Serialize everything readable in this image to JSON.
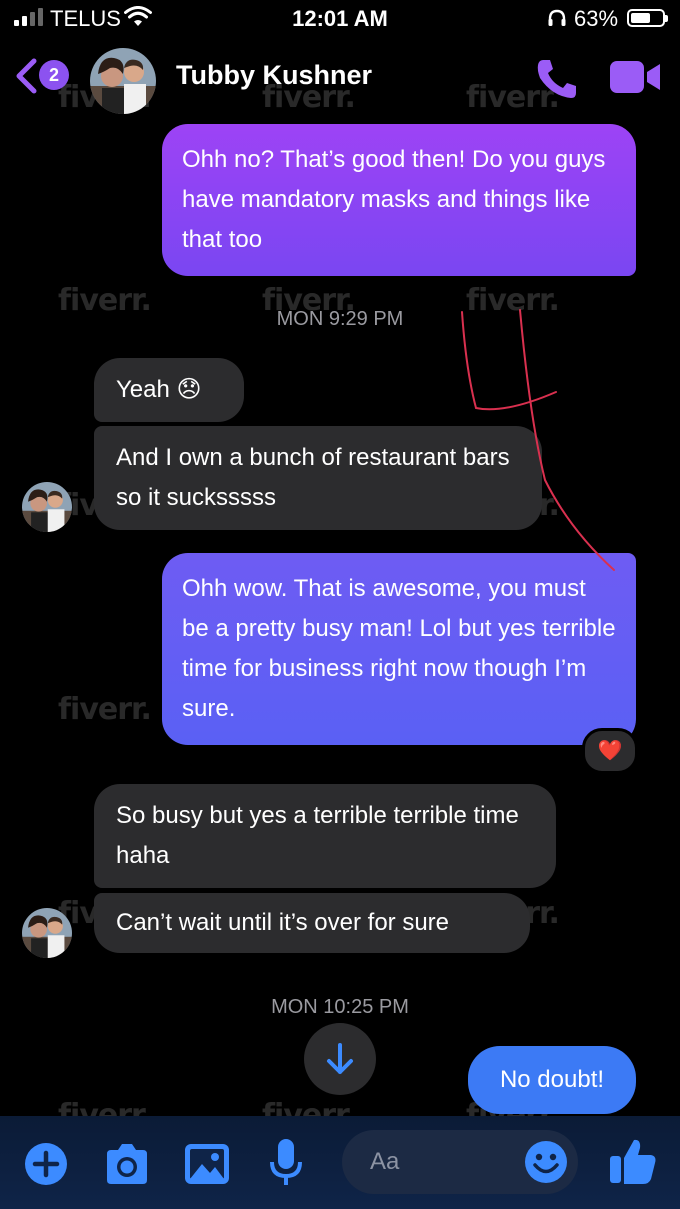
{
  "status_bar": {
    "carrier": "TELUS",
    "time": "12:01 AM",
    "battery_percent": "63%",
    "battery_level": 0.63,
    "icons": [
      "signal-icon",
      "wifi-icon",
      "headphones-icon",
      "battery-icon"
    ]
  },
  "header": {
    "back_badge_count": "2",
    "contact_name": "Tubby Kushner",
    "icons": [
      "back-chevron-icon",
      "phone-icon",
      "video-camera-icon"
    ]
  },
  "watermark": "fiverr.",
  "messages": [
    {
      "direction": "out",
      "text": "Ohh no? That’s good then! Do you guys have mandatory masks and things like that too"
    },
    {
      "type": "timestamp",
      "text": "MON 9:29 PM"
    },
    {
      "direction": "in",
      "text": "Yeah 😞"
    },
    {
      "direction": "in",
      "text": "And I own a bunch of restaurant bars so it sucksssss"
    },
    {
      "direction": "out",
      "text": "Ohh wow. That is awesome, you must be a pretty busy man! Lol but yes terrible time for business right now though I’m sure.",
      "reaction": "❤️"
    },
    {
      "direction": "in",
      "text": "So busy but yes a terrible terrible time haha"
    },
    {
      "direction": "in",
      "text": "Can’t wait until it’s over for sure"
    },
    {
      "type": "timestamp",
      "text": "MON 10:25 PM"
    },
    {
      "direction": "out",
      "text": "No doubt!"
    }
  ],
  "composer": {
    "placeholder": "Aa",
    "icons": [
      "plus-icon",
      "camera-icon",
      "image-icon",
      "microphone-icon",
      "emoji-icon",
      "thumbs-up-icon"
    ]
  },
  "colors": {
    "accent": "#8c52f0",
    "outgoing_gradient_top": "#9d43f5",
    "outgoing_blue": "#3c7af5",
    "incoming_bubble": "#2c2c2e",
    "annotation_red": "#d9304f"
  }
}
